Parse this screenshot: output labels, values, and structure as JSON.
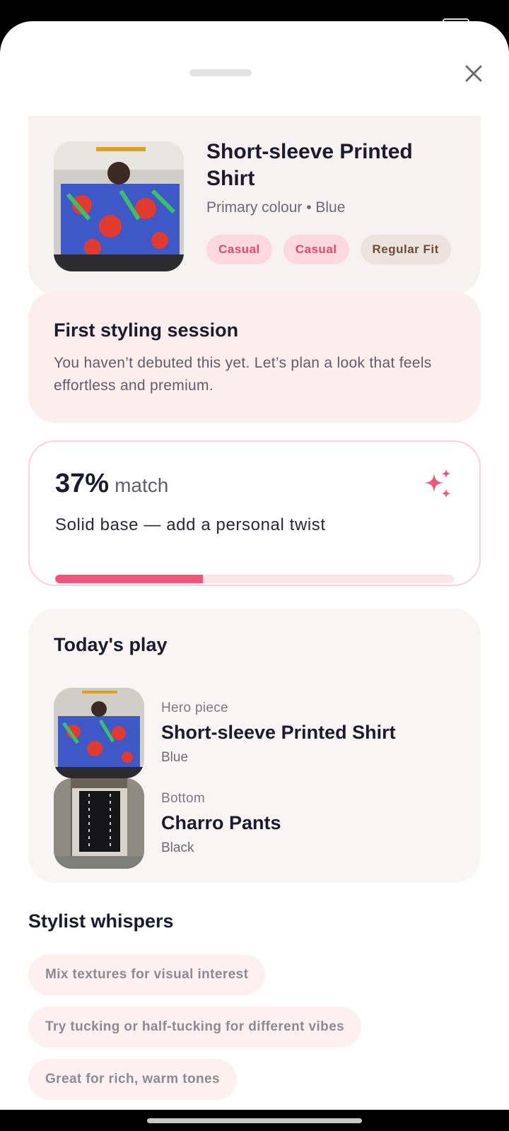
{
  "product": {
    "title": "Short-sleeve Printed Shirt",
    "subtitle": "Primary colour • Blue",
    "tags": [
      "Casual",
      "Casual",
      "Regular Fit"
    ]
  },
  "first_session": {
    "title": "First styling session",
    "body": "You haven’t debuted this yet. Let’s plan a look that feels effortless and premium."
  },
  "match": {
    "percent": "37%",
    "word": "match",
    "tagline": "Solid base — add a personal twist",
    "progress": 0.37
  },
  "todays_play": {
    "title": "Today's play",
    "items": [
      {
        "role": "Hero piece",
        "name": "Short-sleeve Printed Shirt",
        "color": "Blue"
      },
      {
        "role": "Bottom",
        "name": "Charro Pants",
        "color": "Black"
      }
    ]
  },
  "whispers": {
    "title": "Stylist whispers",
    "tips": [
      "Mix textures for visual interest",
      "Try tucking or half-tucking for different vibes",
      "Great for rich, warm tones"
    ]
  },
  "icons": {
    "close": "close-icon",
    "sparkle": "sparkle-icon"
  },
  "colors": {
    "accent": "#f4547a",
    "chip_pink_bg": "#fcd9de",
    "chip_beige_bg": "#ece2de"
  }
}
